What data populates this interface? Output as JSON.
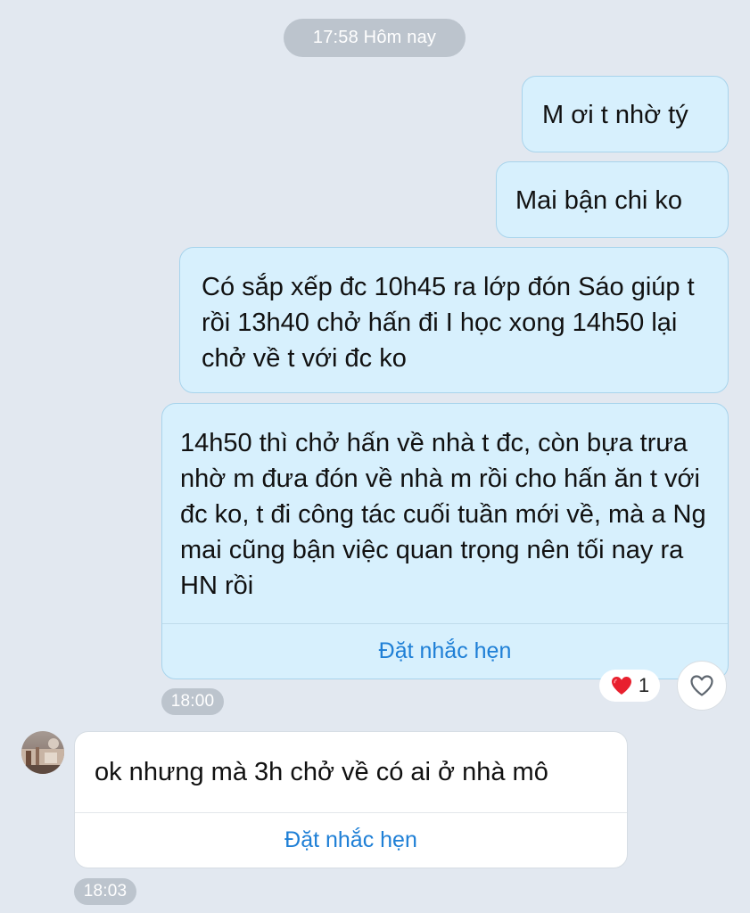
{
  "header_time": "17:58 Hôm nay",
  "messages": [
    {
      "text": "M ơi t nhờ tý"
    },
    {
      "text": "Mai bận chi ko"
    },
    {
      "text": "Có sắp xếp đc 10h45 ra lớp đón Sáo giúp t rồi 13h40 chở hấn đi I học xong 14h50 lại chở về t với đc ko"
    },
    {
      "text": "14h50 thì chở hấn về nhà t đc, còn bựa trưa nhờ m đưa đón về nhà m rồi cho hấn ăn t với đc ko, t đi công tác cuối tuần mới về, mà a Ng mai cũng bận việc quan trọng nên tối nay ra HN rồi",
      "reminder_label": "Đặt nhắc hẹn",
      "time": "18:00",
      "reaction": {
        "emoji": "❤️",
        "count": "1"
      }
    },
    {
      "text": "ok nhưng mà 3h chở về có ai ở nhà mô",
      "reminder_label": "Đặt nhắc hẹn",
      "time": "18:03"
    }
  ],
  "colors": {
    "background": "#e2e8f0",
    "sent_bubble": "#d7f0fd",
    "received_bubble": "#ffffff",
    "link": "#1e7fd6",
    "time_pill": "#bcc4cd",
    "heart": "#e8202e"
  },
  "icons": {
    "reaction": "heart-icon",
    "react_button": "heart-outline-icon"
  }
}
